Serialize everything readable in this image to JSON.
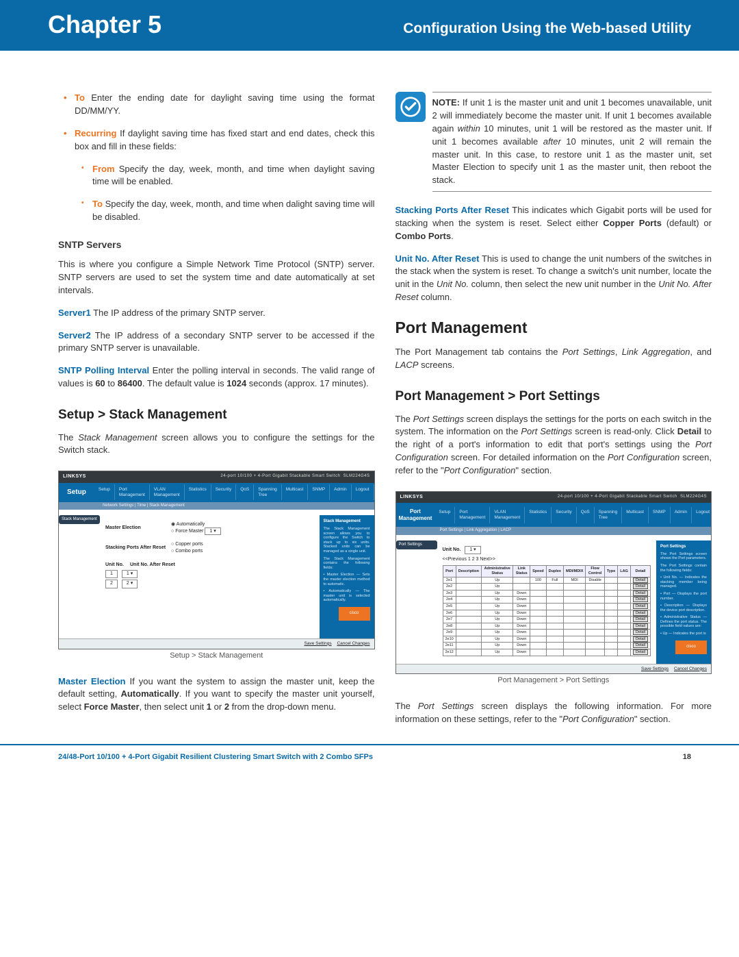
{
  "header": {
    "left": "Chapter 5",
    "right": "Configuration Using the Web-based Utility"
  },
  "leftcol": {
    "items": [
      {
        "type": "bullet1",
        "term": "To",
        "text": " Enter the ending date for daylight saving time using the format DD/MM/YY."
      },
      {
        "type": "bullet1",
        "term": "Recurring",
        "text": " If daylight saving time has fixed start and end dates, check this box and fill in these fields:"
      },
      {
        "type": "bullet2",
        "term": "From",
        "text": " Specify the day, week, month, and time when daylight saving time will be enabled."
      },
      {
        "type": "bullet2",
        "term": "To",
        "text": " Specify the day, week, month, and time when dalight saving time will be disabled."
      }
    ],
    "sntp_heading": "SNTP Servers",
    "sntp_intro": "This is where you configure a Simple Network Time Protocol (SNTP) server. SNTP servers are used to set the system time and date automatically at set intervals.",
    "server1_label": "Server1",
    "server1_text": "  The IP address of the primary SNTP server.",
    "server2_label": "Server2",
    "server2_text": "  The IP address of a secondary SNTP server to be accessed if the primary SNTP server is unavailable.",
    "poll_label": "SNTP Polling Interval",
    "poll_text_a": " Enter the polling interval in seconds. The valid range of values is ",
    "poll_val1": "60",
    "poll_text_b": " to ",
    "poll_val2": "86400",
    "poll_text_c": ". The default value is ",
    "poll_val3": "1024",
    "poll_text_d": " seconds (approx. 17 minutes).",
    "stack_heading": "Setup > Stack Management",
    "stack_intro_a": "The ",
    "stack_intro_i": "Stack Management",
    "stack_intro_b": " screen allows you to configure the settings for the Switch stack.",
    "figcap1": "Setup > Stack Management",
    "master_label": "Master Election",
    "master_text_a": " If you want the system to assign the master unit, keep the default setting, ",
    "master_b1": "Automatically",
    "master_text_b": ". If you want to specify the master unit yourself, select ",
    "master_b2": "Force Master",
    "master_text_c": ", then select unit ",
    "master_b3": "1",
    "master_text_d": " or ",
    "master_b4": "2",
    "master_text_e": " from the drop-down menu."
  },
  "rightcol": {
    "note_label": "NOTE:",
    "note_text": " If unit 1 is the master unit and unit 1 becomes unavailable, unit 2 will immediately become the master unit. If unit 1 becomes available again within 10 minutes, unit 1 will be restored as the master unit. If unit 1 becomes available after 10 minutes, unit 2 will remain the master unit. In this case, to restore unit 1 as the master unit, set Master Election to specify unit 1 as the master unit, then reboot the stack.",
    "note_i1": "within",
    "note_i2": "after",
    "spar_label": "Stacking Ports After Reset",
    "spar_text": "  This indicates which Gigabit ports will be used for stacking when the system is reset. Select either  ",
    "spar_b1": "Copper Ports",
    "spar_mid": " (default) or ",
    "spar_b2": "Combo Ports",
    "spar_end": ".",
    "unar_label": "Unit No. After Reset",
    "unar_text_a": "  This is used to change the unit numbers of the switches in the stack when the system is reset. To change a switch's unit number, locate the unit in the ",
    "unar_i1": "Unit No.",
    "unar_text_b": " column, then select the new unit number in the ",
    "unar_i2": "Unit No. After Reset",
    "unar_text_c": " column.",
    "pm_heading": "Port Management",
    "pm_intro_a": "The Port Management tab contains the ",
    "pm_i1": "Port Settings",
    "pm_intro_b": ", ",
    "pm_i2": "Link Aggregation",
    "pm_intro_c": ", and ",
    "pm_i3": "LACP",
    "pm_intro_d": " screens.",
    "pmps_heading": "Port Management > Port Settings",
    "pmps_p1_a": "The ",
    "pmps_p1_i1": "Port Settings",
    "pmps_p1_b": " screen displays the settings for the ports on each switch in the system. The information on the ",
    "pmps_p1_i2": "Port Settings",
    "pmps_p1_c": " screen is read-only. Click ",
    "pmps_p1_bold": "Detail",
    "pmps_p1_d": " to the right of a port's information to edit that port's settings using the ",
    "pmps_p1_i3": "Port Configuration",
    "pmps_p1_e": " screen. For detailed information on the ",
    "pmps_p1_i4": "Port Configuration",
    "pmps_p1_f": " screen, refer to the \"",
    "pmps_p1_i5": "Port Configuration",
    "pmps_p1_g": "\" section.",
    "figcap2": "Port Management > Port Settings",
    "pmps_p2_a": "The ",
    "pmps_p2_i1": "Port Settings",
    "pmps_p2_b": " screen displays the following information. For more information on these settings, refer to the \"",
    "pmps_p2_i2": "Port Configuration",
    "pmps_p2_c": "\" section."
  },
  "mock1": {
    "brand": "LINKSYS",
    "model": "24-port 10/100 + 4-Port Gigabit Stackable Smart Switch",
    "model_no": "SLM224G4S",
    "sidelabel": "Setup",
    "tabs": [
      "Setup",
      "Port Management",
      "VLAN Management",
      "Statistics",
      "Security",
      "QoS",
      "Spanning Tree",
      "Multicast",
      "SNMP",
      "Admin",
      "Logout"
    ],
    "subtabs": "Network Settings | Time | Stack Management",
    "leftnav": "Stack Management",
    "master_election_label": "Master Election",
    "master_opts": [
      "Automatically",
      "Force Master"
    ],
    "spar_label": "Stacking Ports After Reset",
    "spar_opts": [
      "Copper ports",
      "Combo ports"
    ],
    "table_head": [
      "Unit No.",
      "Unit No. After Reset"
    ],
    "rows": [
      {
        "u": "1",
        "a": "1"
      },
      {
        "u": "2",
        "a": "2"
      }
    ],
    "right_title": "Stack Management",
    "save": "Save Settings",
    "cancel": "Cancel Changes",
    "cisco": "cisco"
  },
  "mock2": {
    "brand": "LINKSYS",
    "model": "24-port 10/100 + 4-Port Gigabit Stackable Smart Switch",
    "model_no": "SLM224G4S",
    "sidelabel": "Port Management",
    "tabs": [
      "Setup",
      "Port Management",
      "VLAN Management",
      "Statistics",
      "Security",
      "QoS",
      "Spanning Tree",
      "Multicast",
      "SNMP",
      "Admin",
      "Logout"
    ],
    "subtabs": "Port Settings | Link Aggregation | LACP",
    "leftnav": "Port Settings",
    "unitno_label": "Unit No.",
    "unitno_val": "1",
    "pager": "<<Previous   1  2  3  Next>>",
    "headers": [
      "Port",
      "Description",
      "Administrative Status",
      "Link Status",
      "Speed",
      "Duplex",
      "MDI/MDIX",
      "Flow Control",
      "Type",
      "LAG",
      "Detail"
    ],
    "rows": [
      {
        "p": "2e1",
        "as": "Up",
        "ls": "",
        "sp": "100",
        "dp": "Full",
        "mdi": "MDI",
        "fc": "Disable",
        "d": "Detail"
      },
      {
        "p": "2e2",
        "as": "Up",
        "ls": "",
        "sp": "",
        "dp": "",
        "mdi": "",
        "fc": "",
        "d": "Detail"
      },
      {
        "p": "2e3",
        "as": "Up",
        "ls": "Down",
        "sp": "",
        "dp": "",
        "mdi": "",
        "fc": "",
        "d": "Detail"
      },
      {
        "p": "2e4",
        "as": "Up",
        "ls": "Down",
        "sp": "",
        "dp": "",
        "mdi": "",
        "fc": "",
        "d": "Detail"
      },
      {
        "p": "2e5",
        "as": "Up",
        "ls": "Down",
        "sp": "",
        "dp": "",
        "mdi": "",
        "fc": "",
        "d": "Detail"
      },
      {
        "p": "2e6",
        "as": "Up",
        "ls": "Down",
        "sp": "",
        "dp": "",
        "mdi": "",
        "fc": "",
        "d": "Detail"
      },
      {
        "p": "2e7",
        "as": "Up",
        "ls": "Down",
        "sp": "",
        "dp": "",
        "mdi": "",
        "fc": "",
        "d": "Detail"
      },
      {
        "p": "2e8",
        "as": "Up",
        "ls": "Down",
        "sp": "",
        "dp": "",
        "mdi": "",
        "fc": "",
        "d": "Detail"
      },
      {
        "p": "2e9",
        "as": "Up",
        "ls": "Down",
        "sp": "",
        "dp": "",
        "mdi": "",
        "fc": "",
        "d": "Detail"
      },
      {
        "p": "2e10",
        "as": "Up",
        "ls": "Down",
        "sp": "",
        "dp": "",
        "mdi": "",
        "fc": "",
        "d": "Detail"
      },
      {
        "p": "2e11",
        "as": "Up",
        "ls": "Down",
        "sp": "",
        "dp": "",
        "mdi": "",
        "fc": "",
        "d": "Detail"
      },
      {
        "p": "2e12",
        "as": "Up",
        "ls": "Down",
        "sp": "",
        "dp": "",
        "mdi": "",
        "fc": "",
        "d": "Detail"
      }
    ],
    "right_title": "Port Settings",
    "save": "Save Settings",
    "cancel": "Cancel Changes",
    "cisco": "cisco"
  },
  "footer": {
    "text": "24/48-Port 10/100 + 4-Port Gigabit Resilient Clustering Smart Switch with 2 Combo SFPs",
    "page": "18"
  }
}
